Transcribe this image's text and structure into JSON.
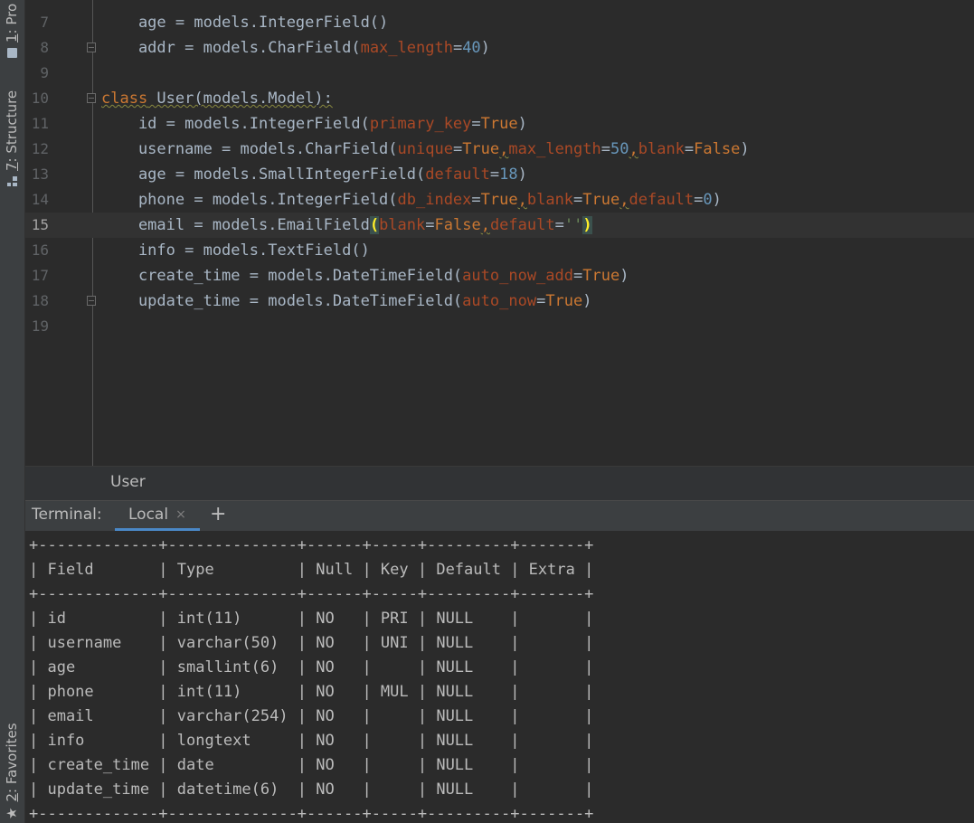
{
  "left_toolbar": {
    "project": {
      "num": "1",
      "rest": ": Pro"
    },
    "structure": {
      "num": "7",
      "rest": ": Structure"
    },
    "favorites": {
      "num": "2",
      "rest": ": Favorites"
    }
  },
  "editor": {
    "lines": [
      {
        "num": "7",
        "tokens": [
          {
            "t": "    age = models.IntegerField()",
            "c": ""
          }
        ]
      },
      {
        "num": "8",
        "fold": true,
        "tokens": [
          {
            "t": "    addr = models.CharField(",
            "c": ""
          },
          {
            "t": "max_length",
            "c": "p"
          },
          {
            "t": "=",
            "c": ""
          },
          {
            "t": "40",
            "c": "n"
          },
          {
            "t": ")",
            "c": ""
          }
        ]
      },
      {
        "num": "9",
        "tokens": []
      },
      {
        "num": "10",
        "fold": true,
        "tokens": [
          {
            "t": "class",
            "c": "k w"
          },
          {
            "t": " User(models.Model):",
            "c": "w"
          }
        ]
      },
      {
        "num": "11",
        "tokens": [
          {
            "t": "    id = models.IntegerField(",
            "c": ""
          },
          {
            "t": "primary_key",
            "c": "p"
          },
          {
            "t": "=",
            "c": ""
          },
          {
            "t": "True",
            "c": "k"
          },
          {
            "t": ")",
            "c": ""
          }
        ]
      },
      {
        "num": "12",
        "tokens": [
          {
            "t": "    username = models.CharField(",
            "c": ""
          },
          {
            "t": "unique",
            "c": "p"
          },
          {
            "t": "=",
            "c": ""
          },
          {
            "t": "True",
            "c": "k"
          },
          {
            "t": ",",
            "c": "k w"
          },
          {
            "t": "max_length",
            "c": "p"
          },
          {
            "t": "=",
            "c": ""
          },
          {
            "t": "50",
            "c": "n"
          },
          {
            "t": ",",
            "c": "k w"
          },
          {
            "t": "blank",
            "c": "p"
          },
          {
            "t": "=",
            "c": ""
          },
          {
            "t": "False",
            "c": "k"
          },
          {
            "t": ")",
            "c": ""
          }
        ]
      },
      {
        "num": "13",
        "tokens": [
          {
            "t": "    age = models.SmallIntegerField(",
            "c": ""
          },
          {
            "t": "default",
            "c": "p"
          },
          {
            "t": "=",
            "c": ""
          },
          {
            "t": "18",
            "c": "n"
          },
          {
            "t": ")",
            "c": ""
          }
        ]
      },
      {
        "num": "14",
        "tokens": [
          {
            "t": "    phone = models.IntegerField(",
            "c": ""
          },
          {
            "t": "db_index",
            "c": "p"
          },
          {
            "t": "=",
            "c": ""
          },
          {
            "t": "True",
            "c": "k"
          },
          {
            "t": ",",
            "c": "k w"
          },
          {
            "t": "blank",
            "c": "p"
          },
          {
            "t": "=",
            "c": ""
          },
          {
            "t": "True",
            "c": "k"
          },
          {
            "t": ",",
            "c": "k w"
          },
          {
            "t": "default",
            "c": "p"
          },
          {
            "t": "=",
            "c": ""
          },
          {
            "t": "0",
            "c": "n"
          },
          {
            "t": ")",
            "c": ""
          }
        ]
      },
      {
        "num": "15",
        "current": true,
        "tokens": [
          {
            "t": "    email = models.EmailField",
            "c": ""
          },
          {
            "t": "(",
            "c": "hl"
          },
          {
            "t": "blank",
            "c": "p"
          },
          {
            "t": "=",
            "c": ""
          },
          {
            "t": "False",
            "c": "k"
          },
          {
            "t": ",",
            "c": "k w"
          },
          {
            "t": "default",
            "c": "p"
          },
          {
            "t": "=",
            "c": ""
          },
          {
            "t": "''",
            "c": "s"
          },
          {
            "t": ")",
            "c": "hl"
          }
        ]
      },
      {
        "num": "16",
        "tokens": [
          {
            "t": "    info = models.TextField()",
            "c": ""
          }
        ]
      },
      {
        "num": "17",
        "tokens": [
          {
            "t": "    create_time = models.DateTimeField(",
            "c": ""
          },
          {
            "t": "auto_now_add",
            "c": "p"
          },
          {
            "t": "=",
            "c": ""
          },
          {
            "t": "True",
            "c": "k"
          },
          {
            "t": ")",
            "c": ""
          }
        ]
      },
      {
        "num": "18",
        "fold": true,
        "tokens": [
          {
            "t": "    update_time = models.DateTimeField(",
            "c": ""
          },
          {
            "t": "auto_now",
            "c": "p"
          },
          {
            "t": "=",
            "c": ""
          },
          {
            "t": "True",
            "c": "k"
          },
          {
            "t": ")",
            "c": ""
          }
        ]
      },
      {
        "num": "19",
        "tokens": []
      }
    ]
  },
  "breadcrumb": {
    "label": "User"
  },
  "terminal": {
    "title": "Terminal:",
    "tab_label": "Local",
    "close_glyph": "×",
    "add_glyph": "+",
    "lines": [
      "+-------------+--------------+------+-----+---------+-------+",
      "| Field       | Type         | Null | Key | Default | Extra |",
      "+-------------+--------------+------+-----+---------+-------+",
      "| id          | int(11)      | NO   | PRI | NULL    |       |",
      "| username    | varchar(50)  | NO   | UNI | NULL    |       |",
      "| age         | smallint(6)  | NO   |     | NULL    |       |",
      "| phone       | int(11)      | NO   | MUL | NULL    |       |",
      "| email       | varchar(254) | NO   |     | NULL    |       |",
      "| info        | longtext     | NO   |     | NULL    |       |",
      "| create_time | date         | NO   |     | NULL    |       |",
      "| update_time | datetime(6)  | NO   |     | NULL    |       |",
      "+-------------+--------------+------+-----+---------+-------+"
    ]
  }
}
